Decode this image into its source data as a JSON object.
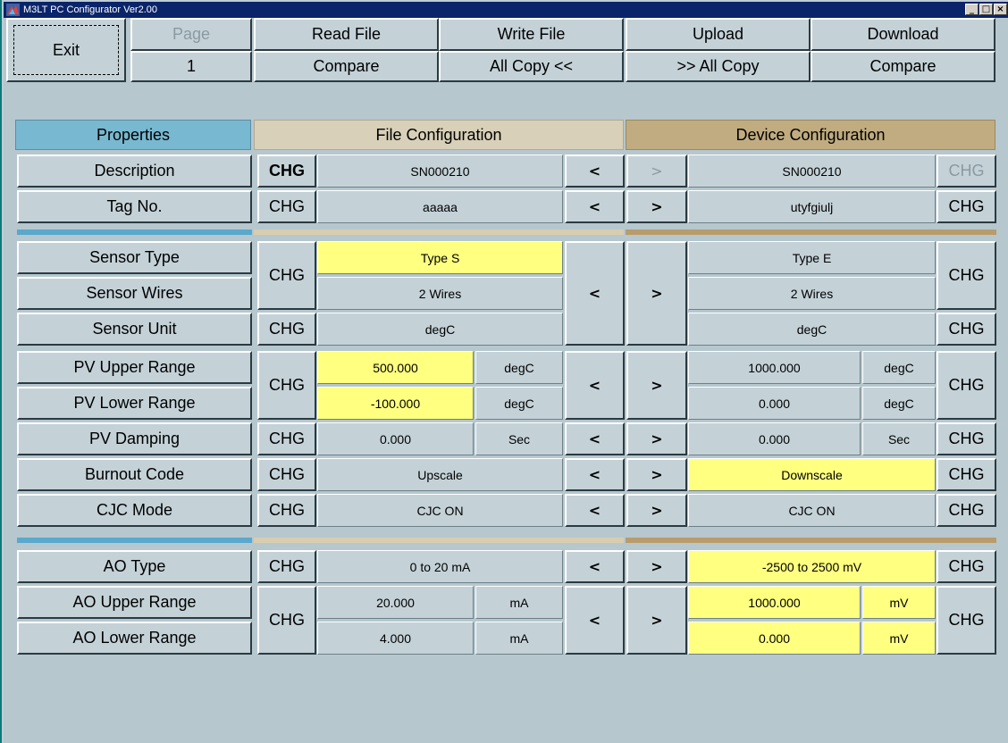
{
  "window": {
    "title": "M3LT PC Configurator Ver2.00",
    "min_glyph": "_",
    "max_glyph": "□",
    "close_glyph": "×"
  },
  "toolbar": {
    "exit": "Exit",
    "page_label": "Page",
    "page_value": "1",
    "read_file": "Read File",
    "write_file": "Write File",
    "upload": "Upload",
    "download": "Download",
    "compare_left": "Compare",
    "all_copy_left": "All Copy  <<",
    "all_copy_right": ">>  All Copy",
    "compare_right": "Compare"
  },
  "headers": {
    "properties": "Properties",
    "file": "File Configuration",
    "device": "Device Configuration"
  },
  "labels": {
    "chg": "CHG",
    "left_arrow": "<",
    "right_arrow": ">"
  },
  "rows": {
    "description": {
      "label": "Description",
      "file": "SN000210",
      "device": "SN000210"
    },
    "tag_no": {
      "label": "Tag No.",
      "file": "aaaaa",
      "device": "utyfgiulj"
    },
    "sensor_type": {
      "label": "Sensor Type",
      "file": "Type S",
      "device": "Type E"
    },
    "sensor_wires": {
      "label": "Sensor Wires",
      "file": "2 Wires",
      "device": "2 Wires"
    },
    "sensor_unit": {
      "label": "Sensor Unit",
      "file": "degC",
      "device": "degC"
    },
    "pv_upper": {
      "label": "PV Upper Range",
      "file": "500.000",
      "file_unit": "degC",
      "device": "1000.000",
      "device_unit": "degC"
    },
    "pv_lower": {
      "label": "PV Lower Range",
      "file": "-100.000",
      "file_unit": "degC",
      "device": "0.000",
      "device_unit": "degC"
    },
    "pv_damping": {
      "label": "PV Damping",
      "file": "0.000",
      "file_unit": "Sec",
      "device": "0.000",
      "device_unit": "Sec"
    },
    "burnout": {
      "label": "Burnout Code",
      "file": "Upscale",
      "device": "Downscale"
    },
    "cjc": {
      "label": "CJC Mode",
      "file": "CJC ON",
      "device": "CJC ON"
    },
    "ao_type": {
      "label": "AO Type",
      "file": "0 to 20 mA",
      "device": "-2500 to 2500 mV"
    },
    "ao_upper": {
      "label": "AO Upper Range",
      "file": "20.000",
      "file_unit": "mA",
      "device": "1000.000",
      "device_unit": "mV"
    },
    "ao_lower": {
      "label": "AO Lower Range",
      "file": "4.000",
      "file_unit": "mA",
      "device": "0.000",
      "device_unit": "mV"
    }
  },
  "colors": {
    "title_bar": "#0a246a",
    "properties_header": "#78b8d0",
    "file_header": "#d8d0b8",
    "device_header": "#c0ac80",
    "highlight": "#ffff80",
    "background": "#b6c7ce"
  }
}
